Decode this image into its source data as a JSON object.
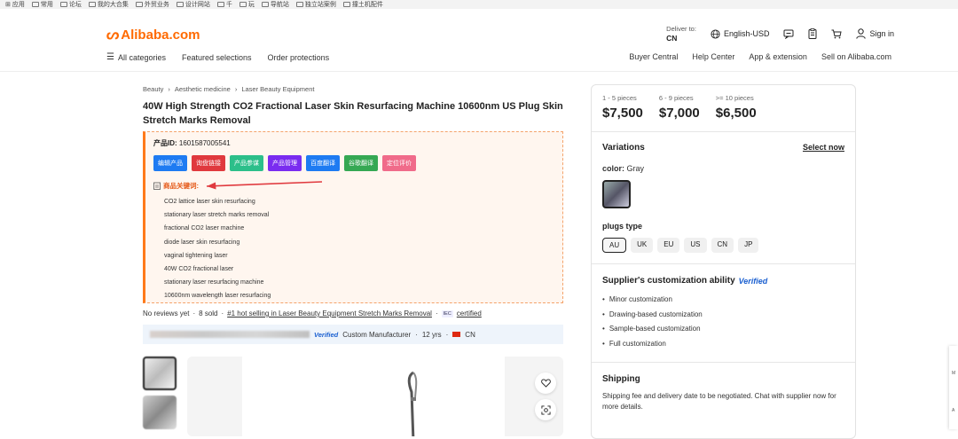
{
  "bookmarks": [
    "应用",
    "常用",
    "论坛",
    "我的大合集",
    "外贸业务",
    "设计网站",
    "千",
    "玩",
    "导航站",
    "独立站案例",
    "撞土机配件"
  ],
  "header": {
    "logo": "Alibaba.com",
    "deliver_label": "Deliver to:",
    "deliver_value": "CN",
    "language": "English-USD",
    "sign_in": "Sign in"
  },
  "nav": {
    "all_categories": "All categories",
    "featured": "Featured selections",
    "order_protections": "Order protections",
    "buyer_central": "Buyer Central",
    "help_center": "Help Center",
    "app_extension": "App & extension",
    "sell": "Sell on Alibaba.com"
  },
  "breadcrumb": [
    "Beauty",
    "Aesthetic medicine",
    "Laser Beauty Equipment"
  ],
  "product": {
    "title": "40W High Strength CO2 Fractional Laser Skin Resurfacing Machine 10600nm US Plug Skin Stretch Marks Removal"
  },
  "plugin": {
    "pid_label": "产品ID:",
    "pid_value": "1601587005541",
    "buttons": [
      {
        "label": "编辑产品",
        "color": "#1e7bf2"
      },
      {
        "label": "询盘链接",
        "color": "#e0393e"
      },
      {
        "label": "产品参谋",
        "color": "#2cbf8a"
      },
      {
        "label": "产品管理",
        "color": "#7a2cf0"
      },
      {
        "label": "百度翻译",
        "color": "#1e7bf2"
      },
      {
        "label": "谷歌翻译",
        "color": "#35a853"
      },
      {
        "label": "定位评价",
        "color": "#f06b8a"
      }
    ],
    "keywords_label": "商品关键词:",
    "keywords": [
      "CO2 lattice laser skin resurfacing",
      "stationary laser stretch marks removal",
      "fractional CO2 laser machine",
      "diode laser skin resurfacing",
      "vaginal tightening laser",
      "40W CO2 fractional laser",
      "stationary laser resurfacing machine",
      "10600nm wavelength laser resurfacing"
    ]
  },
  "stats": {
    "reviews": "No reviews yet",
    "sold": "8 sold",
    "hot_link": "#1 hot selling in Laser Beauty Equipment Stretch Marks Removal",
    "cert_tag": "IEC",
    "certified": "certified"
  },
  "supplier": {
    "verified": "Verified",
    "type": "Custom Manufacturer",
    "years": "12 yrs",
    "country": "CN"
  },
  "pricing": {
    "tiers": [
      {
        "qty": "1 - 5 pieces",
        "price": "$7,500"
      },
      {
        "qty": "6 - 9 pieces",
        "price": "$7,000"
      },
      {
        "qty": ">= 10 pieces",
        "price": "$6,500"
      }
    ]
  },
  "variations": {
    "title": "Variations",
    "select_now": "Select now",
    "color_label": "color:",
    "color_value": "Gray",
    "plugs_label": "plugs type",
    "plugs": [
      "AU",
      "UK",
      "EU",
      "US",
      "CN",
      "JP"
    ],
    "selected_plug": "AU"
  },
  "customization": {
    "title": "Supplier's customization ability",
    "verified": "Verified",
    "items": [
      "Minor customization",
      "Drawing-based customization",
      "Sample-based customization",
      "Full customization"
    ]
  },
  "shipping": {
    "title": "Shipping",
    "text": "Shipping fee and delivery date to be negotiated. Chat with supplier now for more details."
  }
}
